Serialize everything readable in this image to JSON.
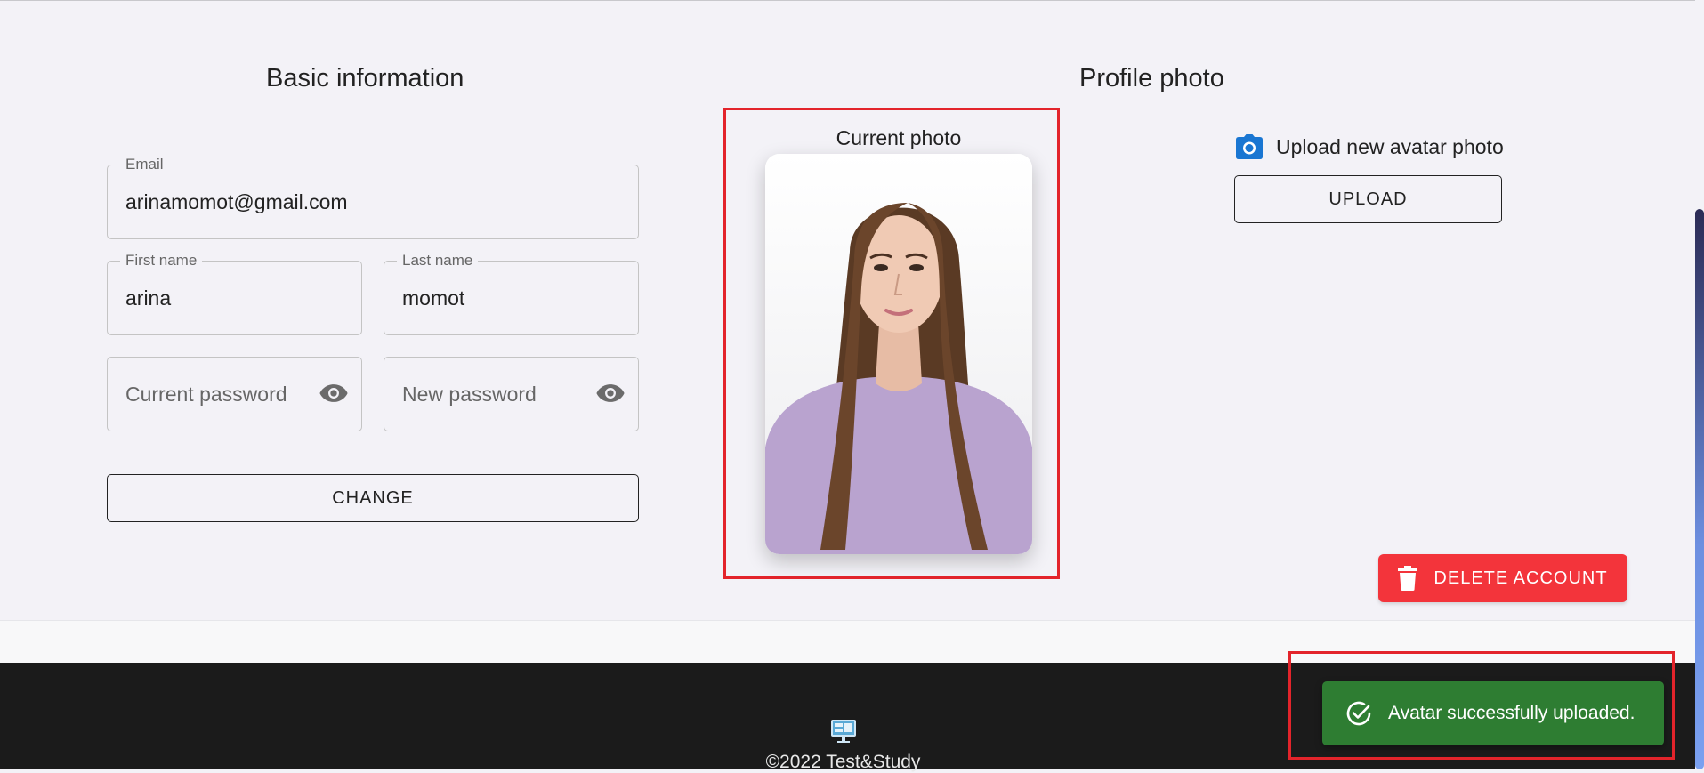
{
  "basic_info": {
    "title": "Basic information",
    "email": {
      "label": "Email",
      "value": "arinamomot@gmail.com"
    },
    "first_name": {
      "label": "First name",
      "value": "arina"
    },
    "last_name": {
      "label": "Last name",
      "value": "momot"
    },
    "current_password": {
      "placeholder": "Current password"
    },
    "new_password": {
      "placeholder": "New password"
    },
    "change_label": "CHANGE"
  },
  "profile_photo": {
    "title": "Profile photo",
    "current_photo_label": "Current photo",
    "upload_text": "Upload new avatar photo",
    "upload_button": "UPLOAD",
    "delete_button": "DELETE ACCOUNT"
  },
  "footer": {
    "copyright": "©2022 Test&Study"
  },
  "toast": {
    "message": "Avatar successfully uploaded."
  },
  "colors": {
    "danger": "#f3343b",
    "success": "#2e7d32",
    "accent": "#1976d2",
    "highlight": "#e3242b"
  }
}
